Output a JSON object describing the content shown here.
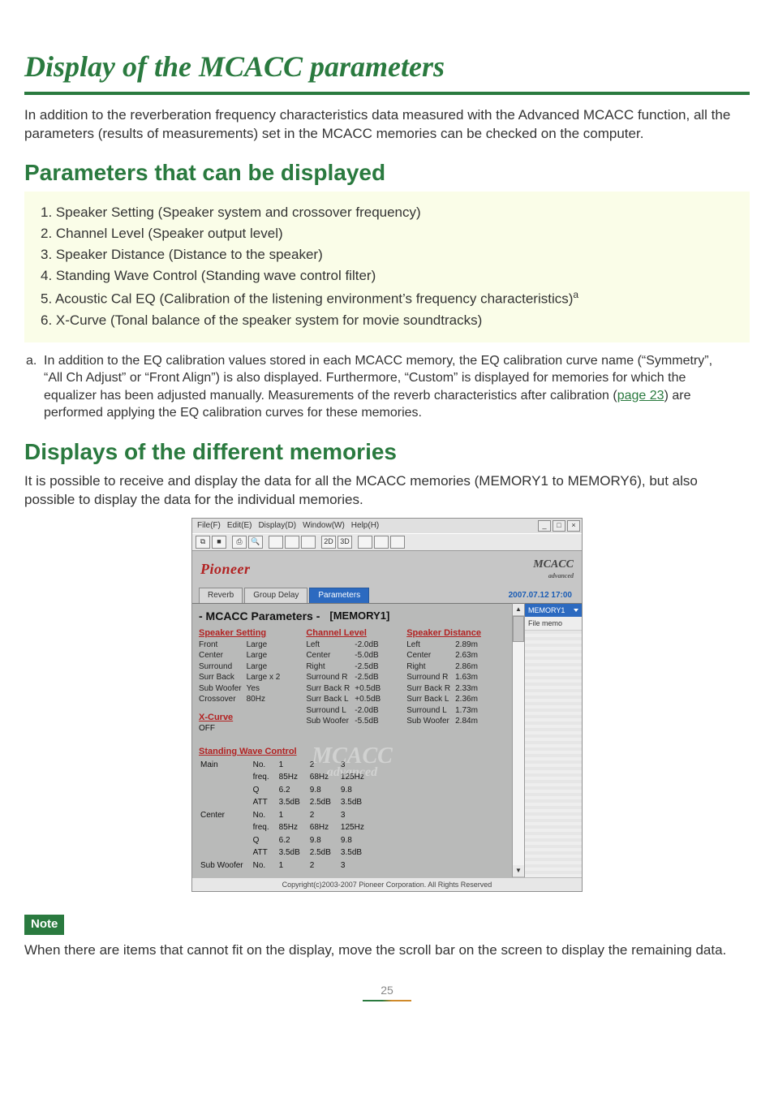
{
  "title": "Display of the MCACC parameters",
  "intro": "In addition to the reverberation frequency characteristics data measured with the Advanced MCACC function, all the parameters (results of measurements) set in the MCACC memories can be checked on the computer.",
  "section1_title": "Parameters that can be displayed",
  "param_list": {
    "i1": "1. Speaker Setting (Speaker system and crossover frequency)",
    "i2": "2. Channel Level (Speaker output level)",
    "i3": "3. Speaker Distance (Distance to the speaker)",
    "i4": "4. Standing Wave Control (Standing wave control filter)",
    "i5_pre": "5. Acoustic Cal EQ (Calibration of the listening environment’s frequency characteristics)",
    "i5_sup": "a",
    "i6": "6. X-Curve (Tonal balance of the speaker system for movie soundtracks)"
  },
  "footnote": {
    "lead": "a.",
    "body_pre": "In addition to the EQ calibration values stored in each MCACC memory, the EQ calibration curve name (“Symmetry”, “All Ch Adjust” or “Front Align”) is also displayed. Furthermore, “Custom” is displayed for memories for which the equalizer has been adjusted manually. Measurements of the reverb characteristics after calibration (",
    "link": "page 23",
    "body_post": ") are performed applying the EQ calibration curves for these memories."
  },
  "section2_title": "Displays of the different memories",
  "section2_body": "It is possible to receive and display the data for all the MCACC memories (MEMORY1 to MEMORY6), but also possible to display the data for the individual memories.",
  "shot": {
    "menus": {
      "m1": "File(F)",
      "m2": "Edit(E)",
      "m3": "Display(D)",
      "m4": "Window(W)",
      "m5": "Help(H)"
    },
    "toolbar_icons": [
      "⎘",
      "■",
      "×",
      "🖶",
      "🔍",
      "",
      "",
      "",
      "",
      "",
      "2D",
      "3D",
      "",
      "",
      ""
    ],
    "brand": "Pioneer",
    "mcacc": "MCACC",
    "mcacc_sub": "advanced",
    "tabs": {
      "t1": "Reverb",
      "t2": "Group Delay",
      "t3": "Parameters"
    },
    "timestamp": "2007.07.12 17:00",
    "memory_selector": "MEMORY1",
    "file_memo": "File memo",
    "params_title": "- MCACC Parameters -",
    "memory_label": "[MEMORY1]",
    "headers": {
      "ss": "Speaker Setting",
      "cl": "Channel Level",
      "sd": "Speaker Distance",
      "xc": "X-Curve",
      "swc": "Standing Wave Control"
    },
    "speaker_setting": {
      "r1": {
        "k": "Front",
        "v": "Large"
      },
      "r2": {
        "k": "Center",
        "v": "Large"
      },
      "r3": {
        "k": "Surround",
        "v": "Large"
      },
      "r4": {
        "k": "Surr Back",
        "v": "Large x 2"
      },
      "r5": {
        "k": "Sub Woofer",
        "v": "Yes"
      },
      "r6": {
        "k": "Crossover",
        "v": "80Hz"
      }
    },
    "xcurve_value": "OFF",
    "channel_level": {
      "r1": {
        "k": "Left",
        "v": "-2.0dB"
      },
      "r2": {
        "k": "Center",
        "v": "-5.0dB"
      },
      "r3": {
        "k": "Right",
        "v": "-2.5dB"
      },
      "r4": {
        "k": "Surround R",
        "v": "-2.5dB"
      },
      "r5": {
        "k": "Surr Back R",
        "v": "+0.5dB"
      },
      "r6": {
        "k": "Surr Back L",
        "v": "+0.5dB"
      },
      "r7": {
        "k": "Surround L",
        "v": "-2.0dB"
      },
      "r8": {
        "k": "Sub Woofer",
        "v": "-5.5dB"
      }
    },
    "speaker_distance": {
      "r1": {
        "k": "Left",
        "v": "2.89m"
      },
      "r2": {
        "k": "Center",
        "v": "2.63m"
      },
      "r3": {
        "k": "Right",
        "v": "2.86m"
      },
      "r4": {
        "k": "Surround R",
        "v": "1.63m"
      },
      "r5": {
        "k": "Surr Back R",
        "v": "2.33m"
      },
      "r6": {
        "k": "Surr Back L",
        "v": "2.36m"
      },
      "r7": {
        "k": "Surround L",
        "v": "1.73m"
      },
      "r8": {
        "k": "Sub Woofer",
        "v": "2.84m"
      }
    },
    "swc": {
      "main_label": "Main",
      "center_label": "Center",
      "sw_label": "Sub Woofer",
      "row_labels": {
        "no": "No.",
        "freq": "freq.",
        "q": "Q",
        "att": "ATT"
      },
      "main": {
        "no": {
          "c1": "1",
          "c2": "2",
          "c3": "3"
        },
        "freq": {
          "c1": "85Hz",
          "c2": "68Hz",
          "c3": "125Hz"
        },
        "q": {
          "c1": "6.2",
          "c2": "9.8",
          "c3": "9.8"
        },
        "att": {
          "c1": "3.5dB",
          "c2": "2.5dB",
          "c3": "3.5dB"
        }
      },
      "center": {
        "no": {
          "c1": "1",
          "c2": "2",
          "c3": "3"
        },
        "freq": {
          "c1": "85Hz",
          "c2": "68Hz",
          "c3": "125Hz"
        },
        "q": {
          "c1": "6.2",
          "c2": "9.8",
          "c3": "9.8"
        },
        "att": {
          "c1": "3.5dB",
          "c2": "2.5dB",
          "c3": "3.5dB"
        }
      },
      "sw": {
        "no": {
          "c1": "1",
          "c2": "2",
          "c3": "3"
        }
      }
    },
    "watermark_top": "MCACC",
    "watermark_bot": "advanced",
    "copyright": "Copyright(c)2003-2007 Pioneer Corporation. All Rights Reserved"
  },
  "note_label": "Note",
  "note_text": "When there are items that cannot fit on the display, move the scroll bar on the screen to display the remaining data.",
  "page_number": "25"
}
